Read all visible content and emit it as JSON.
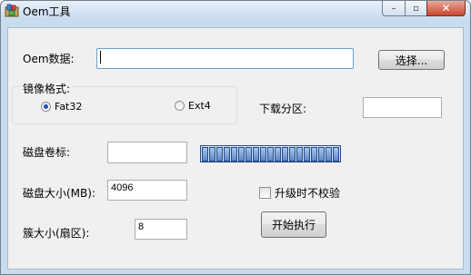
{
  "window": {
    "title": "Oem工具"
  },
  "caption": {
    "minimize": "–",
    "maximize": "▫",
    "close": "✕"
  },
  "oem": {
    "label": "Oem数据:",
    "value": "",
    "browse_label": "选择..."
  },
  "image_format": {
    "group_label": "镜像格式:",
    "options": [
      {
        "label": "Fat32",
        "selected": true
      },
      {
        "label": "Ext4",
        "selected": false
      }
    ]
  },
  "download_partition": {
    "label": "下载分区:",
    "value": ""
  },
  "volume_label": {
    "label": "磁盘卷标:",
    "value": ""
  },
  "progress": {
    "segments": 19,
    "fill_fraction": 1.0
  },
  "disk_size": {
    "label": "磁盘大小(MB):",
    "value": "4096"
  },
  "no_verify": {
    "label": "升级时不校验",
    "checked": false
  },
  "cluster_size": {
    "label": "簇大小(扇区):",
    "value": "8"
  },
  "start_button": {
    "label": "开始执行"
  }
}
